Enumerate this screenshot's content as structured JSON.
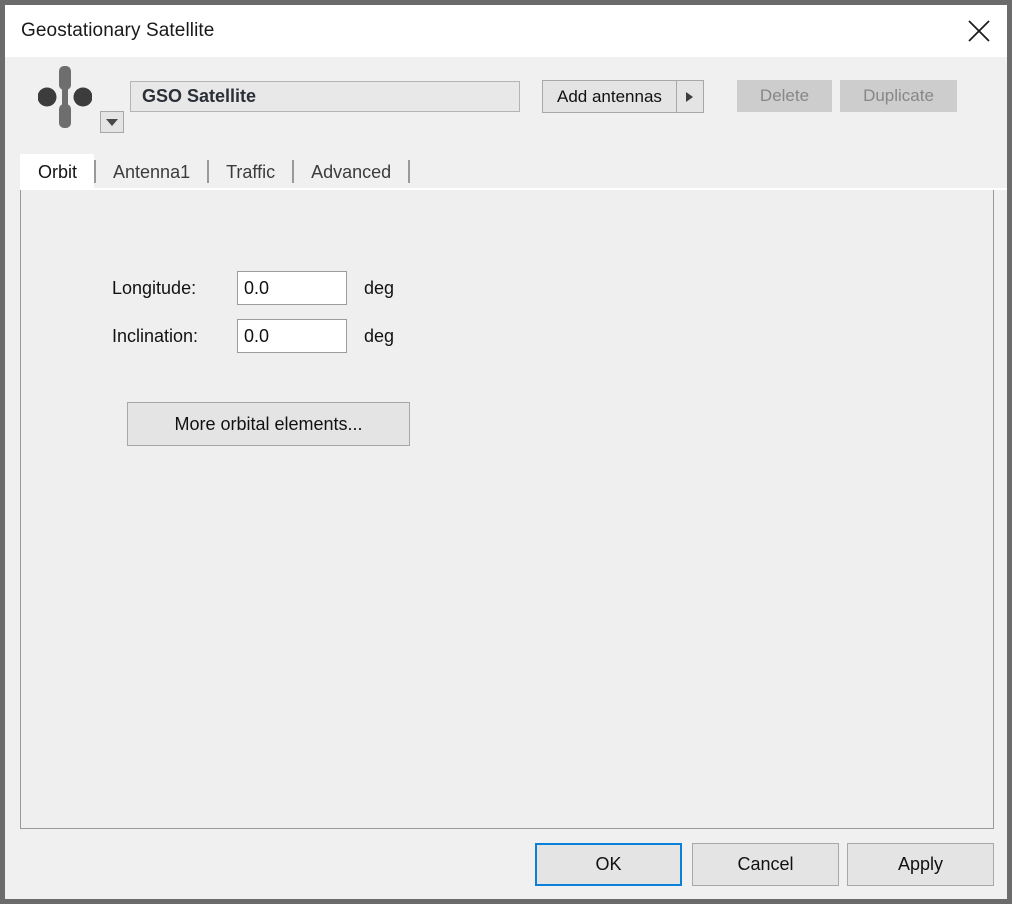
{
  "window": {
    "title": "Geostationary Satellite",
    "close_icon": "close-icon"
  },
  "header": {
    "satellite_icon": "satellite-icon",
    "preset_dropdown_icon": "chevron-down-icon",
    "name_value": "GSO Satellite",
    "name_placeholder": "",
    "add_antennas_label": "Add antennas",
    "add_antennas_arrow_icon": "caret-right-icon",
    "delete_label": "Delete",
    "delete_enabled": false,
    "duplicate_label": "Duplicate",
    "duplicate_enabled": false
  },
  "tabs": [
    {
      "label": "Orbit",
      "active": true
    },
    {
      "label": "Antenna1",
      "active": false
    },
    {
      "label": "Traffic",
      "active": false
    },
    {
      "label": "Advanced",
      "active": false
    }
  ],
  "orbit_tab": {
    "fields": [
      {
        "label": "Longitude:",
        "value": "0.0",
        "unit": "deg"
      },
      {
        "label": "Inclination:",
        "value": "0.0",
        "unit": "deg"
      }
    ],
    "more_orbital_label": "More orbital elements..."
  },
  "footer": {
    "ok_label": "OK",
    "cancel_label": "Cancel",
    "apply_label": "Apply"
  },
  "colors": {
    "accent_focus": "#0a80d8",
    "dialog_bg": "#f0f0f0",
    "panel_bg": "#efefef",
    "border": "#9a9a9a",
    "disabled_text": "#878787",
    "icon_body": "#6e6e6e",
    "icon_dish": "#3c3c3c"
  }
}
